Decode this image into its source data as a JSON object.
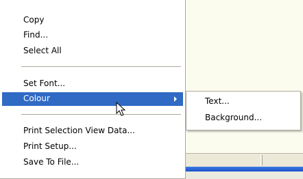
{
  "context_menu": {
    "items": [
      {
        "label": "Copy"
      },
      {
        "label": "Find..."
      },
      {
        "label": "Select All"
      },
      {
        "label": "Set Font..."
      },
      {
        "label": "Colour",
        "highlighted": true,
        "has_submenu": true
      },
      {
        "label": "Print Selection View Data..."
      },
      {
        "label": "Print Setup..."
      },
      {
        "label": "Save To File..."
      }
    ],
    "highlight_color": "#316ac5"
  },
  "submenu": {
    "items": [
      {
        "label": "Text..."
      },
      {
        "label": "Background..."
      }
    ]
  },
  "cursor": {
    "icon": "arrow-pointer-icon"
  }
}
